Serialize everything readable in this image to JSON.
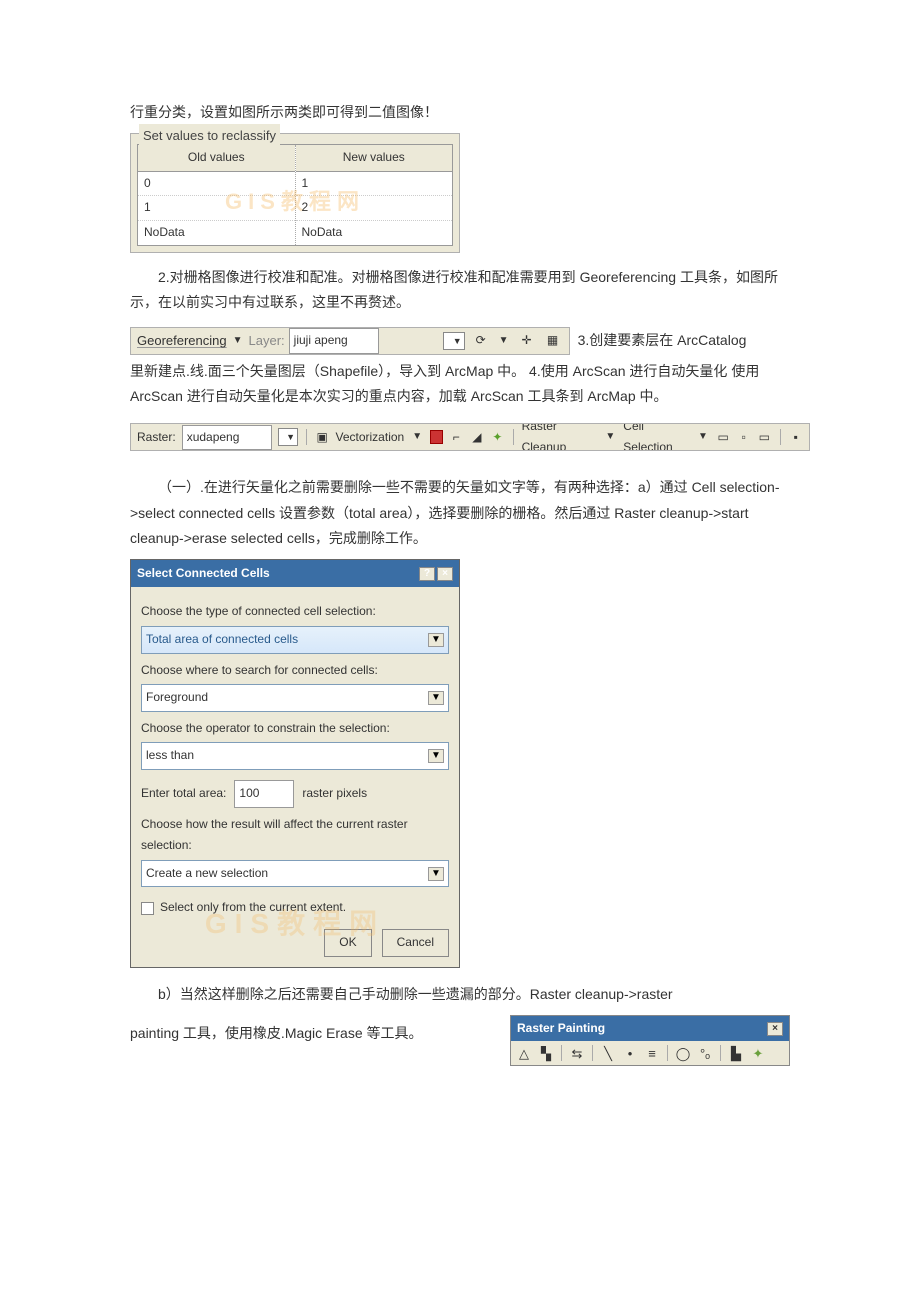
{
  "intro_line": "行重分类，设置如图所示两类即可得到二值图像！",
  "reclass": {
    "title": "Set values to reclassify",
    "old_header": "Old values",
    "new_header": "New values",
    "rows": [
      {
        "old": "0",
        "new": "1"
      },
      {
        "old": "1",
        "new": "2"
      },
      {
        "old": "NoData",
        "new": "NoData"
      }
    ],
    "watermark": "GIS教程网"
  },
  "para_georef": "2.对栅格图像进行校准和配准。对栅格图像进行校准和配准需要用到 Georeferencing 工具条，如图所示，在以前实习中有过联系，这里不再赘述。",
  "georef": {
    "label": "Georeferencing",
    "layer_label": "Layer:",
    "layer_value": "jiuji apeng"
  },
  "trail_georef": "3.创建要素层在 ArcCatalog",
  "para_arcscan": "里新建点.线.面三个矢量图层（Shapefile），导入到 ArcMap 中。  4.使用 ArcScan 进行自动矢量化 使用 ArcScan 进行自动矢量化是本次实习的重点内容，加载 ArcScan 工具条到 ArcMap 中。",
  "arcscan": {
    "raster_label": "Raster:",
    "raster_value": "xudapeng",
    "vectorization": "Vectorization",
    "raster_cleanup": "Raster Cleanup",
    "cell_selection": "Cell Selection"
  },
  "para_cell": "（一）.在进行矢量化之前需要删除一些不需要的矢量如文字等，有两种选择：a）通过 Cell selection->select connected cells 设置参数（total area），选择要删除的栅格。然后通过 Raster cleanup->start cleanup->erase selected cells，完成删除工作。",
  "dialog": {
    "title": "Select Connected Cells",
    "label1": "Choose the type of connected cell selection:",
    "combo1": "Total area of connected cells",
    "label2": "Choose where to search for connected cells:",
    "combo2": "Foreground",
    "label3": "Choose the operator to constrain the selection:",
    "combo3": "less than",
    "area_label": "Enter total area:",
    "area_value": "100",
    "area_unit": "raster pixels",
    "label4": "Choose how the result will affect the current raster selection:",
    "combo4": "Create a new selection",
    "chk": "Select only from the current extent.",
    "ok": "OK",
    "cancel": "Cancel",
    "watermark": "GIS教程网"
  },
  "para_b": "b）当然这样删除之后还需要自己手动删除一些遗漏的部分。Raster cleanup->raster",
  "para_paint": "painting 工具，使用橡皮.Magic Erase 等工具。",
  "raster_painting": {
    "title": "Raster Painting"
  }
}
